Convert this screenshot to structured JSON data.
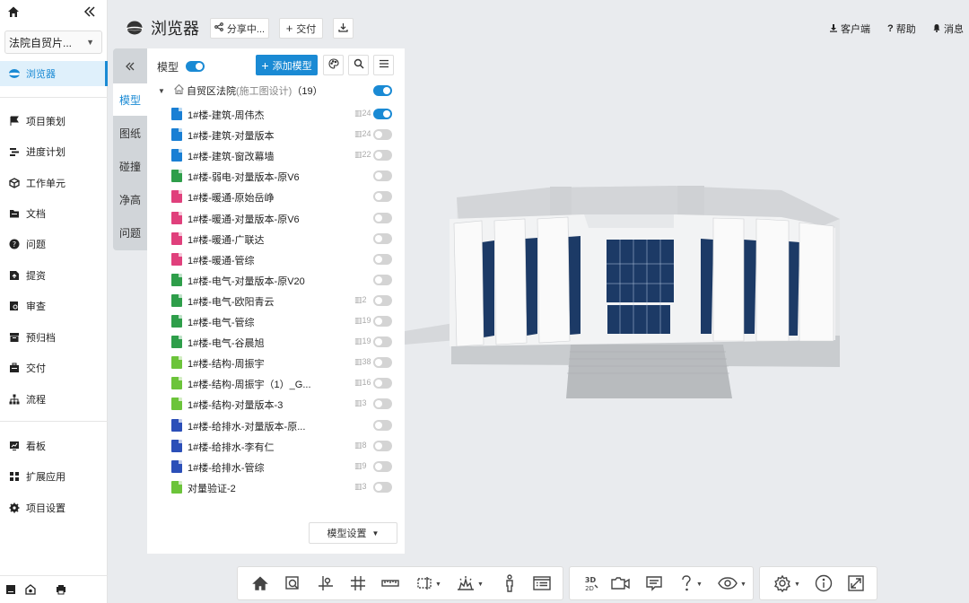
{
  "sidebar": {
    "project": "法院自贸片...",
    "items": [
      {
        "label": "浏览器",
        "icon": "bim-viewer-icon",
        "active": true
      },
      {
        "label": "项目策划",
        "icon": "flag-icon"
      },
      {
        "label": "进度计划",
        "icon": "schedule-icon"
      },
      {
        "label": "工作单元",
        "icon": "cube-icon"
      },
      {
        "label": "文档",
        "icon": "folder-icon"
      },
      {
        "label": "问题",
        "icon": "question-icon"
      },
      {
        "label": "提资",
        "icon": "submit-icon"
      },
      {
        "label": "审查",
        "icon": "review-icon"
      },
      {
        "label": "预归档",
        "icon": "archive-icon"
      },
      {
        "label": "交付",
        "icon": "delivery-icon"
      },
      {
        "label": "流程",
        "icon": "flow-icon"
      },
      {
        "label": "看板",
        "icon": "dashboard-icon"
      },
      {
        "label": "扩展应用",
        "icon": "apps-icon"
      },
      {
        "label": "项目设置",
        "icon": "gear-icon"
      }
    ]
  },
  "header": {
    "title": "浏览器",
    "share": "分享中...",
    "deliver": "交付",
    "client": "客户端",
    "help": "帮助",
    "messages": "消息"
  },
  "side_tabs": [
    "模型",
    "图纸",
    "碰撞",
    "净高",
    "问题"
  ],
  "panel": {
    "label": "模型",
    "add_model": "添加模型",
    "root": {
      "name": "自贸区法院",
      "sub": "(施工图设计)",
      "count": "（19）"
    },
    "models": [
      {
        "name": "1#楼-建筑-周伟杰",
        "cnt": "24",
        "on": true,
        "color": "#1a7fd4"
      },
      {
        "name": "1#楼-建筑-对量版本",
        "cnt": "24",
        "on": false,
        "color": "#1a7fd4"
      },
      {
        "name": "1#楼-建筑-窗改幕墙",
        "cnt": "22",
        "on": false,
        "color": "#1a7fd4"
      },
      {
        "name": "1#楼-弱电-对量版本-原V6",
        "cnt": "",
        "on": false,
        "color": "#2e9e4a"
      },
      {
        "name": "1#楼-暖通-原始岳峥",
        "cnt": "",
        "on": false,
        "color": "#e0407c"
      },
      {
        "name": "1#楼-暖通-对量版本-原V6",
        "cnt": "",
        "on": false,
        "color": "#e0407c"
      },
      {
        "name": "1#楼-暖通-广联达",
        "cnt": "",
        "on": false,
        "color": "#e0407c"
      },
      {
        "name": "1#楼-暖通-管综",
        "cnt": "",
        "on": false,
        "color": "#e0407c"
      },
      {
        "name": "1#楼-电气-对量版本-原V20",
        "cnt": "",
        "on": false,
        "color": "#2e9e4a"
      },
      {
        "name": "1#楼-电气-欧阳青云",
        "cnt": "2",
        "on": false,
        "color": "#2e9e4a"
      },
      {
        "name": "1#楼-电气-管综",
        "cnt": "19",
        "on": false,
        "color": "#2e9e4a"
      },
      {
        "name": "1#楼-电气-谷晨旭",
        "cnt": "19",
        "on": false,
        "color": "#2e9e4a"
      },
      {
        "name": "1#楼-结构-周振宇",
        "cnt": "38",
        "on": false,
        "color": "#6cc43a"
      },
      {
        "name": "1#楼-结构-周振宇（1）_G...",
        "cnt": "16",
        "on": false,
        "color": "#6cc43a"
      },
      {
        "name": "1#楼-结构-对量版本-3",
        "cnt": "3",
        "on": false,
        "color": "#6cc43a"
      },
      {
        "name": "1#楼-给排水-对量版本-原...",
        "cnt": "",
        "on": false,
        "color": "#2b4fb8"
      },
      {
        "name": "1#楼-给排水-李有仁",
        "cnt": "8",
        "on": false,
        "color": "#2b4fb8"
      },
      {
        "name": "1#楼-给排水-管综",
        "cnt": "9",
        "on": false,
        "color": "#2b4fb8"
      },
      {
        "name": "对量验证-2",
        "cnt": "3",
        "on": false,
        "color": "#6cc43a"
      }
    ],
    "settings": "模型设置"
  },
  "colors": {
    "accent": "#1a8ad4"
  }
}
